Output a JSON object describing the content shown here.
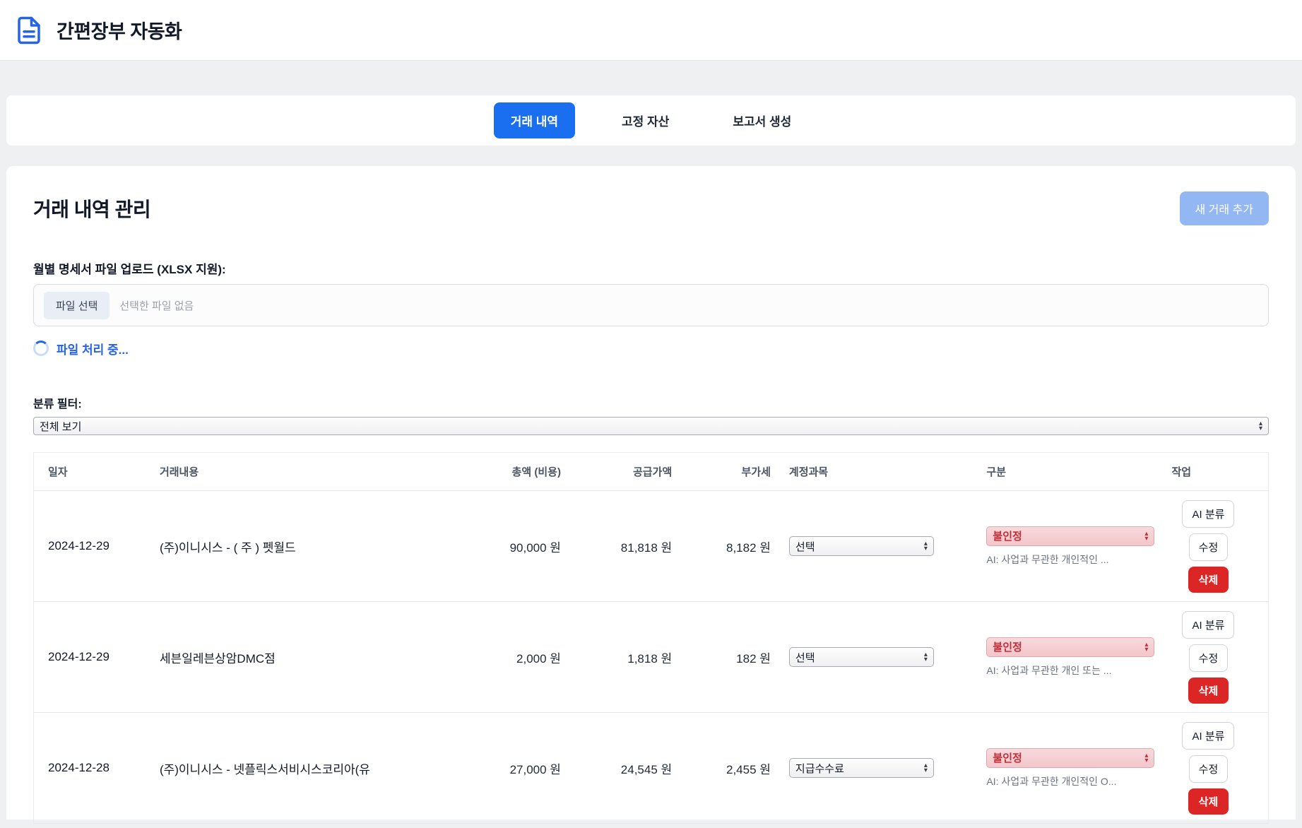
{
  "app": {
    "title": "간편장부 자동화"
  },
  "tabs": {
    "items": [
      {
        "label": "거래 내역"
      },
      {
        "label": "고정 자산"
      },
      {
        "label": "보고서 생성"
      }
    ]
  },
  "page": {
    "title": "거래 내역 관리",
    "add_transaction_button": "새 거래 추가"
  },
  "upload": {
    "label": "월별 명세서 파일 업로드 (XLSX 지원):",
    "file_select_button": "파일 선택",
    "no_file_text": "선택한 파일 없음",
    "processing_text": "파일 처리 중..."
  },
  "filter": {
    "label": "분류 필터:",
    "value": "전체 보기"
  },
  "table": {
    "headers": [
      "일자",
      "거래내용",
      "총액 (비용)",
      "공급가액",
      "부가세",
      "계정과목",
      "구분",
      "작업"
    ],
    "action_labels": {
      "ai_classify": "AI 분류",
      "edit": "수정",
      "delete": "삭제"
    },
    "rows": [
      {
        "date": "2024-12-29",
        "description": "(주)이니시스 - ( 주 ) 펫월드",
        "total": "90,000 원",
        "supply_value": "81,818 원",
        "vat": "8,182 원",
        "account_value": "선택",
        "classification_value": "불인정",
        "ai_note": "AI: 사업과 무관한 개인적인 ..."
      },
      {
        "date": "2024-12-29",
        "description": "세븐일레븐상암DMC점",
        "total": "2,000 원",
        "supply_value": "1,818 원",
        "vat": "182 원",
        "account_value": "선택",
        "classification_value": "불인정",
        "ai_note": "AI: 사업과 무관한 개인 또는 ..."
      },
      {
        "date": "2024-12-28",
        "description": "(주)이니시스 - 넷플릭스서비시스코리아(유",
        "total": "27,000 원",
        "supply_value": "24,545 원",
        "vat": "2,455 원",
        "account_value": "지급수수료",
        "classification_value": "불인정",
        "ai_note": "AI: 사업과 무관한 개인적인 O..."
      }
    ]
  },
  "colors": {
    "accent_blue": "#1a6ef0",
    "add_button_blue": "#93b7f2",
    "processing_blue": "#2563eb",
    "danger_red": "#dc2626",
    "classification_bg": "#f3c6cb",
    "classification_text": "#c22f3a"
  }
}
